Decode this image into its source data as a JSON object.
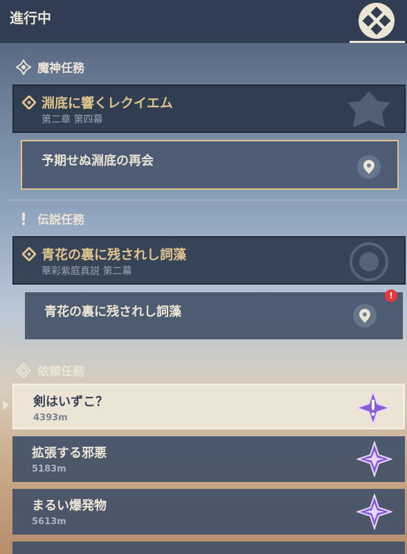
{
  "header": {
    "title": "進行中",
    "menu_icon": "quest-menu-icon"
  },
  "sections": {
    "archon": {
      "title": "魔神任務",
      "icon": "archon-quest-icon"
    },
    "story": {
      "title": "伝説任務",
      "icon": "story-quest-icon"
    },
    "commission": {
      "title": "依頼任務",
      "icon": "commission-icon"
    }
  },
  "archon_quest": {
    "title": "淵底に響くレクイエム",
    "subtitle": "第二章 第四幕",
    "step": "予期せぬ淵底の再会"
  },
  "story_quest": {
    "title": "青花の裏に残されし詞藻",
    "subtitle": "華彩紫庭真説 第二幕",
    "step": "青花の裏に残されし詞藻",
    "alert": "!"
  },
  "commissions": [
    {
      "name": "剣はいずこ？",
      "distance": "4393m",
      "selected": true
    },
    {
      "name": "拡張する邪悪",
      "distance": "5183m",
      "selected": false
    },
    {
      "name": "まるい爆発物",
      "distance": "5613m",
      "selected": false
    }
  ],
  "colors": {
    "accent_gold": "#dfc38d",
    "cream": "#ece5d6",
    "panel": "#445268",
    "purple": "#8a5bd6"
  }
}
